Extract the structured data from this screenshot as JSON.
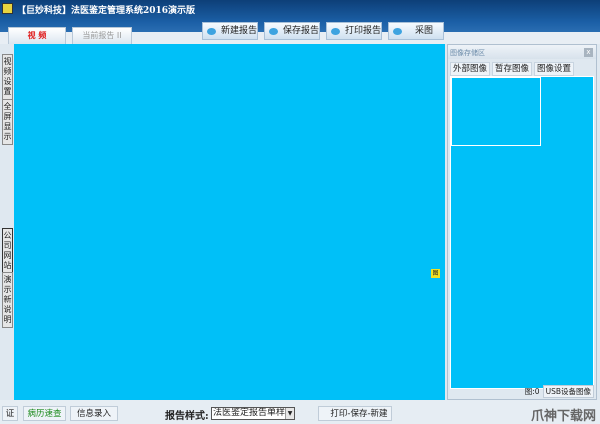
{
  "window": {
    "title": "【巨妙科技】法医鉴定管理系统2016演示版"
  },
  "tabs": [
    {
      "label": "视 频"
    },
    {
      "label": "当前报告 II"
    }
  ],
  "toolbar": [
    {
      "label": "新建报告"
    },
    {
      "label": "保存报告"
    },
    {
      "label": "打印报告"
    },
    {
      "label": "采图"
    }
  ],
  "left_buttons": [
    {
      "label": "视频设置"
    },
    {
      "label": "全屏显示"
    },
    {
      "label": "公司网站"
    },
    {
      "label": "演示新说明"
    }
  ],
  "video_marker": "图",
  "panel": {
    "title": "图像存储区",
    "close": "x",
    "tools": [
      "外部图像",
      "暂存图像",
      "图像设置"
    ],
    "count": "图:0",
    "usb": "USB设备图像"
  },
  "bottom": {
    "cert": "证",
    "records": "病历速查",
    "info": "信息录入",
    "style_label": "报告样式:",
    "style_value": "法医鉴定报告单样",
    "print_save_new": "打印-保存-新建",
    "watermark": "爪神下载网"
  }
}
